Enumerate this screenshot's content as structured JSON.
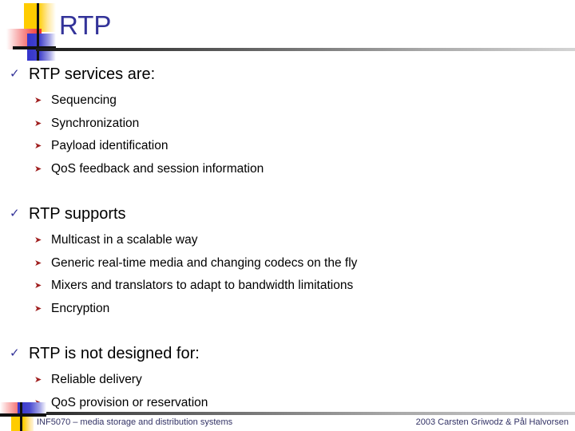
{
  "slide": {
    "title": "RTP",
    "title_color": "#333399",
    "bullet_level1_glyph": "✓",
    "bullet_level1_name": "check-bullet-icon",
    "bullet_level1_color": "#333399",
    "bullet_level2_glyph": "➤",
    "bullet_level2_name": "arrow-bullet-icon",
    "bullet_level2_color": "#A02020",
    "groups": [
      {
        "heading": "RTP services are:",
        "items": [
          "Sequencing",
          "Synchronization",
          "Payload identification",
          "QoS feedback and session information"
        ]
      },
      {
        "heading": "RTP supports",
        "items": [
          "Multicast in a scalable way",
          "Generic real-time media and changing codecs on the fly",
          "Mixers and translators to adapt to bandwidth limitations",
          "Encryption"
        ]
      },
      {
        "heading": "RTP is not designed for:",
        "items": [
          "Reliable delivery",
          "QoS provision or reservation"
        ]
      }
    ]
  },
  "footer": {
    "left": "INF5070 – media storage and distribution systems",
    "right": "2003  Carsten Griwodz & Pål Halvorsen",
    "text_color": "#333366"
  },
  "decor": {
    "logo_yellow": "#FFCC00",
    "logo_red": "#F03030",
    "logo_blue": "#3333CC",
    "rule_dark": "#1a1a1a",
    "rule_light": "#d4d4d4"
  }
}
